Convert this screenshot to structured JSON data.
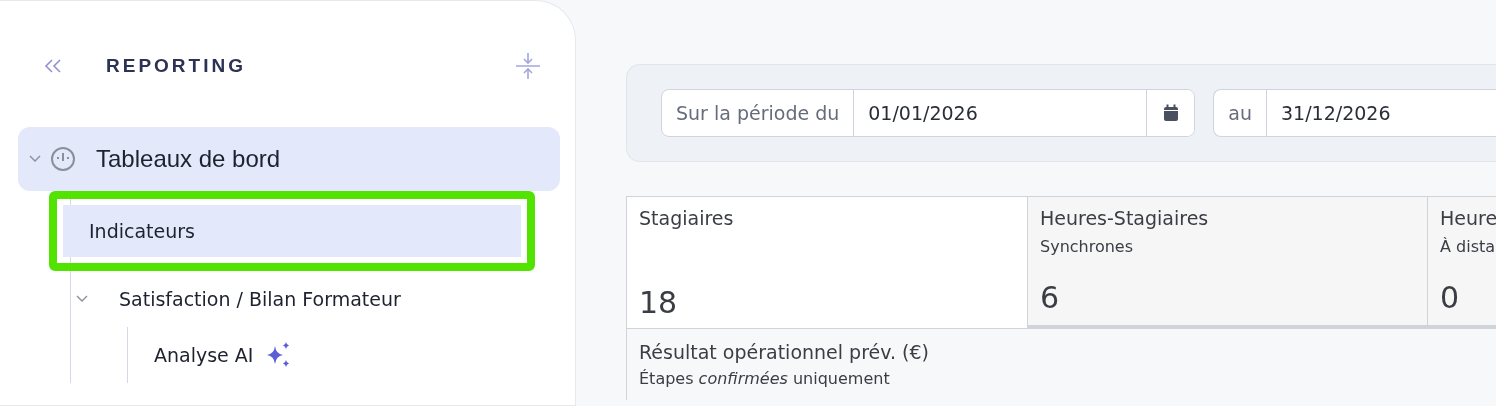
{
  "sidebar": {
    "title": "REPORTING",
    "tree": [
      {
        "label": "Tableaux de bord",
        "kind": "gauge",
        "expanded": true,
        "children": [
          {
            "label": "Indicateurs",
            "selected": true,
            "highlighted": true
          },
          {
            "label": "Satisfaction / Bilan Formateur",
            "expanded": true,
            "selected": false,
            "children": [
              {
                "label": "Analyse AI",
                "kind": "ai",
                "selected": false
              }
            ]
          }
        ]
      }
    ]
  },
  "filter": {
    "from_label": "Sur la période du",
    "from_value": "01/01/2026",
    "to_label": "au",
    "to_value": "31/12/2026"
  },
  "cards": [
    {
      "title": "Stagiaires",
      "value": "18",
      "selected": true
    },
    {
      "title": "Heures-Stagiaires",
      "subtitle": "Synchrones",
      "value": "6",
      "selected": false
    },
    {
      "title": "Heure",
      "subtitle": "À dista",
      "value": "0",
      "selected": false
    }
  ],
  "result": {
    "title": "Résultat opérationnel prév. (€)",
    "note": "Étapes *confirmées* uniquement"
  }
}
